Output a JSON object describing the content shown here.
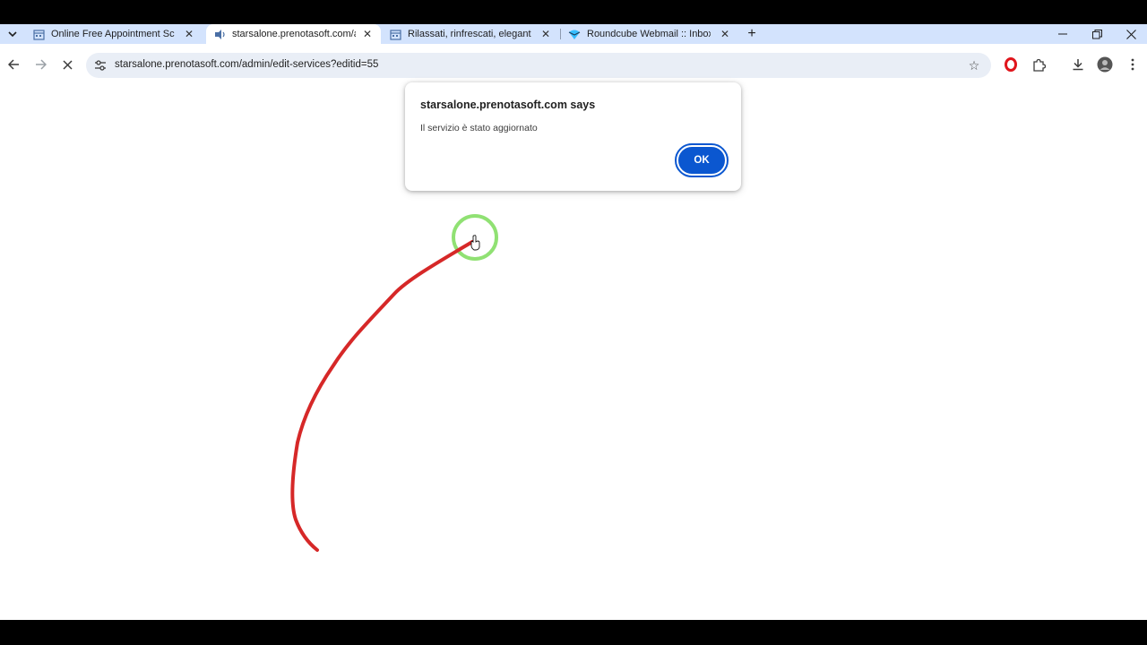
{
  "browser": {
    "tabs": [
      {
        "title": "Online Free Appointment Sche",
        "icon": "calendar-icon",
        "active": false
      },
      {
        "title": "starsalone.prenotasoft.com/ad",
        "icon": "media-icon",
        "active": true
      },
      {
        "title": "Rilassati, rinfrescati, eleganti || I",
        "icon": "calendar-icon",
        "active": false
      },
      {
        "title": "Roundcube Webmail :: Inbox",
        "icon": "roundcube-icon",
        "active": false
      }
    ],
    "url": "starsalone.prenotasoft.com/admin/edit-services?editid=55"
  },
  "dialog": {
    "title": "starsalone.prenotasoft.com says",
    "message": "Il servizio è stato aggiornato",
    "ok_label": "OK"
  },
  "colors": {
    "chrome_bg": "#d3e3fd",
    "ok_button": "#0b57d0",
    "annotation_stroke": "#d62828",
    "cursor_highlight": "#7ddc5a"
  }
}
